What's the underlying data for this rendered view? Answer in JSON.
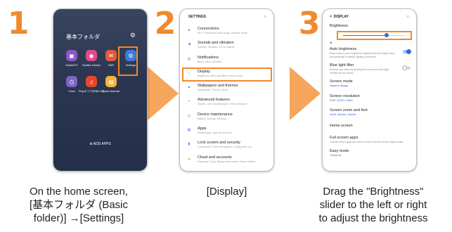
{
  "steps": [
    {
      "number": "1",
      "caption_lines": [
        "On the home screen,",
        "[基本フォルダ (Basic",
        "folder)] →[Settings]"
      ]
    },
    {
      "number": "2",
      "caption_lines": [
        "[Display]"
      ]
    },
    {
      "number": "3",
      "caption_lines": [
        "Drag the \"Brightness\"",
        "slider to the left or right",
        "to adjust the brightness"
      ]
    }
  ],
  "home_screen": {
    "folder_title": "基本フォルダ",
    "settings_icon_glyph": "⚙",
    "apps": [
      {
        "label": "MobileTV",
        "icon": "tv-app-icon",
        "glyph": "▣",
        "color": "#8b58c4"
      },
      {
        "label": "Radiko Hiroba",
        "icon": "radiko-app-icon",
        "glyph": "◉",
        "color": "#e14a8f"
      },
      {
        "label": "SNS",
        "icon": "sns-app-icon",
        "glyph": "✉",
        "color": "#e25a3b"
      },
      {
        "label": "Settings",
        "icon": "settings-app-icon",
        "glyph": "⚙",
        "color": "#3b7bd8"
      },
      {
        "label": "Clock",
        "icon": "clock-app-icon",
        "glyph": "◷",
        "color": "#7a64c6"
      },
      {
        "label": "Playエリア(EBM ID)",
        "icon": "play-app-icon",
        "glyph": "♫",
        "color": "#e8472d"
      },
      {
        "label": "Basic Manual",
        "icon": "manual-app-icon",
        "glyph": "▤",
        "color": "#f3b43c"
      }
    ],
    "add_apps": "⊕ ADD APPS"
  },
  "settings_screen": {
    "title": "SETTINGS",
    "search_glyph": "⌕",
    "items": [
      {
        "title": "Connections",
        "sub": "Wi-Fi, Bluetooth, Data usage, Airplane mode",
        "icon": "connections-icon",
        "glyph": "◈",
        "color": "#4a9be6"
      },
      {
        "title": "Sounds and vibration",
        "sub": "Sounds, Vibration, Do not disturb",
        "icon": "sound-icon",
        "glyph": "◀",
        "color": "#7f7fe8"
      },
      {
        "title": "Notifications",
        "sub": "Block, allow, prioritize",
        "icon": "notifications-icon",
        "glyph": "▤",
        "color": "#e96f6f"
      },
      {
        "title": "Display",
        "sub": "Brightness, Blue light filter, Home screen",
        "icon": "display-icon",
        "glyph": "☼",
        "color": "#5bbc6a"
      },
      {
        "title": "Wallpapers and themes",
        "sub": "Wallpapers, Themes, Icons",
        "icon": "wallpapers-icon",
        "glyph": "▲",
        "color": "#b064d4"
      },
      {
        "title": "Advanced features",
        "sub": "Games, One-handed mode, Video enhancer",
        "icon": "advanced-features-icon",
        "glyph": "✦",
        "color": "#f0a14a"
      },
      {
        "title": "Device maintenance",
        "sub": "Battery, Storage, Memory",
        "icon": "maintenance-icon",
        "glyph": "◎",
        "color": "#2fb7a6"
      },
      {
        "title": "Apps",
        "sub": "Default apps, App permissions",
        "icon": "apps-icon",
        "glyph": "▦",
        "color": "#6a83e6"
      },
      {
        "title": "Lock screen and security",
        "sub": "Lock screen, Face Recognition, Fingerprints, Iris",
        "icon": "lock-icon",
        "glyph": "▮",
        "color": "#6a6fe0"
      },
      {
        "title": "Cloud and accounts",
        "sub": "Samsung Cloud, Backup and restore, Smart Switch",
        "icon": "cloud-icon",
        "glyph": "☁",
        "color": "#f2a72e"
      }
    ]
  },
  "display_screen": {
    "back_glyph": "<",
    "title": "DISPLAY",
    "search_glyph": "⌕",
    "brightness_label": "Brightness",
    "brightness_level": 0.7,
    "auto_brightness": {
      "title": "Auto brightness",
      "sub": "Keep track of your brightness adjustments and apply them automatically in similar lighting conditions.",
      "enabled": true
    },
    "blue_light": {
      "title": "Blue light filter",
      "sub": "Reduce eye strain by limiting the amount of blue light emitted by the screen.",
      "enabled": false
    },
    "screen_mode": {
      "title": "Screen mode",
      "sub": "Adaptive display"
    },
    "screen_resolution": {
      "title": "Screen resolution",
      "sub": "FHD+ (2220 x 1080)"
    },
    "screen_zoom": {
      "title": "Screen zoom and font",
      "sub": "Small, Medium, Default"
    },
    "home_screen": {
      "title": "Home screen"
    },
    "full_screen_apps": {
      "title": "Full screen apps",
      "sub": "Choose which apps you want to use in the full screen aspect ratio."
    },
    "easy_mode": {
      "title": "Easy mode",
      "sub": "Turned off"
    }
  },
  "colors": {
    "accent": "#f08a2c",
    "arrow": "#f6a55c",
    "link_blue": "#2a6acf"
  }
}
